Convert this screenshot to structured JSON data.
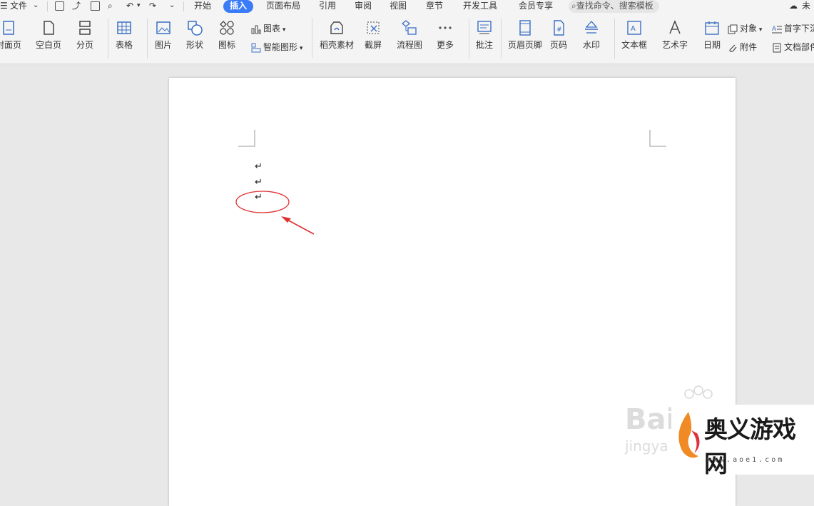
{
  "menubar": {
    "file": "文件",
    "tabs": [
      "开始",
      "插入",
      "页面布局",
      "引用",
      "审阅",
      "视图",
      "章节",
      "开发工具",
      "会员专享"
    ],
    "active_tab": "插入",
    "search_placeholder": "查找命令、搜索模板",
    "cloud_label": "未"
  },
  "ribbon": {
    "cover": "封面页",
    "blank": "空白页",
    "page_break": "分页",
    "table": "表格",
    "picture": "图片",
    "shape": "形状",
    "icon": "图标",
    "chart": "图表",
    "smartart": "智能图形",
    "material": "稻壳素材",
    "screenshot": "截屏",
    "flowchart": "流程图",
    "more": "更多",
    "comment": "批注",
    "header_footer": "页眉页脚",
    "page_number": "页码",
    "watermark": "水印",
    "textbox": "文本框",
    "wordart": "艺术字",
    "date": "日期",
    "object": "对象",
    "attachment": "附件",
    "dropcap": "首字下沉",
    "doc_parts": "文档部件"
  },
  "document": {
    "paragraph_marks": [
      "↵",
      "↵",
      "↵"
    ]
  },
  "annotation": {
    "color": "#e03131"
  },
  "watermark": {
    "baidu_text": "Bai",
    "jingyan_text": "jingya",
    "site_name": "奥义游戏网",
    "site_url": "www.aoe1.com"
  },
  "colors": {
    "accent": "#3a7bf7",
    "icon_blue": "#3a6fc4"
  }
}
